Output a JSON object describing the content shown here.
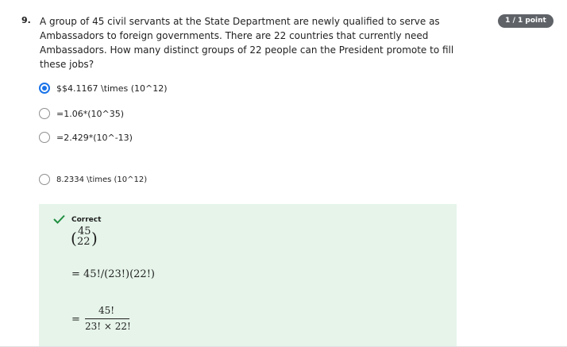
{
  "question": {
    "number": "9.",
    "text": "A group of 45 civil servants at the State Department are newly qualified to serve as Ambassadors to foreign governments. There are 22 countries that currently need Ambassadors. How many distinct groups of 22 people can the President promote to fill these jobs?",
    "points": "1 / 1 point"
  },
  "options": [
    {
      "label": "$$4.1167 \\times (10^12)",
      "selected": true
    },
    {
      "label": "=1.06*(10^35)",
      "selected": false
    },
    {
      "label": "=2.429*(10^-13)",
      "selected": false
    },
    {
      "label": "8.2334 \\times (10^12)",
      "selected": false
    }
  ],
  "feedback": {
    "status": "Correct",
    "binom_open": "(",
    "binom_n": "45",
    "binom_k": "22",
    "binom_close": ")",
    "step1": "= 45!/(23!)(22!)",
    "step2_sign": "=",
    "step2_numerator": "45!",
    "step2_denominator": "23! × 22!"
  },
  "colors": {
    "accent": "#1a73e8",
    "feedback_bg": "#e6f4ea",
    "check": "#1e8e3e",
    "badge": "#5f6368"
  },
  "icons": {
    "check": "check-icon"
  }
}
